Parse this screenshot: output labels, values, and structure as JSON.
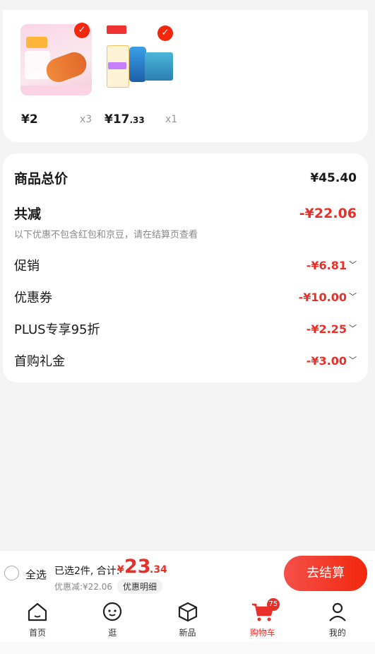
{
  "products": [
    {
      "price_int": "¥2",
      "price_dec": "",
      "qty": "x3"
    },
    {
      "price_int": "¥17",
      "price_dec": ".33",
      "qty": "x1"
    }
  ],
  "summary": {
    "total_label": "商品总价",
    "total_value": "¥45.40",
    "reduce_label": "共减",
    "reduce_value": "-¥22.06",
    "note": "以下优惠不包含红包和京豆，请在结算页查看",
    "items": [
      {
        "label": "促销",
        "value": "-¥6.81"
      },
      {
        "label": "优惠券",
        "value": "-¥10.00"
      },
      {
        "label": "PLUS专享95折",
        "value": "-¥2.25"
      },
      {
        "label": "首购礼金",
        "value": "-¥3.00"
      }
    ]
  },
  "bar": {
    "select_all": "全选",
    "selected": "已选2件, 合计:",
    "yen": "¥",
    "total_int": "23",
    "total_dec": ".34",
    "discount": "优惠减:¥22.06",
    "detail": "优惠明细",
    "checkout": "去结算"
  },
  "tabs": [
    {
      "label": "首页"
    },
    {
      "label": "逛"
    },
    {
      "label": "新品"
    },
    {
      "label": "购物车",
      "badge": "75"
    },
    {
      "label": "我的"
    }
  ],
  "colors": {
    "accent": "#e8302a"
  }
}
